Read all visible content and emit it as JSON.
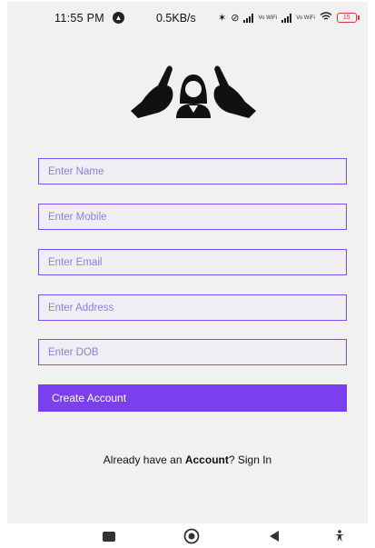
{
  "status_bar": {
    "time": "11:55 PM",
    "net_speed": "0.5KB/s",
    "volte_1": "Vo WiFi",
    "volte_2": "Vo WiFi",
    "battery": "15"
  },
  "form": {
    "name_placeholder": "Enter Name",
    "mobile_placeholder": "Enter Mobile",
    "email_placeholder": "Enter Email",
    "address_placeholder": "Enter Address",
    "dob_placeholder": "Enter DOB",
    "submit_label": "Create Account"
  },
  "footer": {
    "prefix": "Already have an ",
    "bold_word": "Account",
    "suffix": "? ",
    "link": "Sign In"
  },
  "colors": {
    "accent": "#7b3fee",
    "field_border": "#7e4ef0",
    "placeholder": "#8f7ddd",
    "screen_bg": "#f1f1f1"
  },
  "icons": [
    "alert-icon",
    "bluetooth-icon",
    "mute-icon",
    "signal-icon",
    "wifi-icon",
    "battery-icon",
    "logo-icon",
    "square-nav-icon",
    "home-nav-icon",
    "back-nav-icon",
    "accessibility-nav-icon"
  ]
}
